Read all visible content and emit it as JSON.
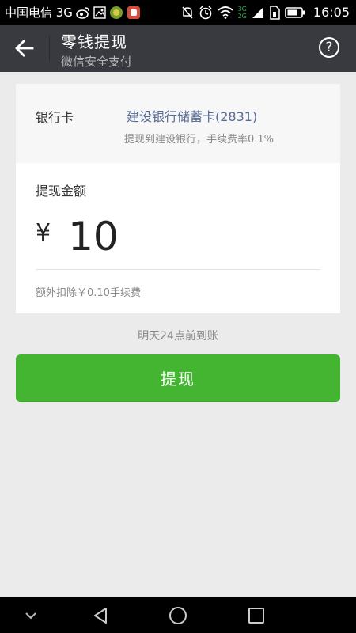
{
  "status_bar": {
    "carrier": "中国电信 3G",
    "network_top": "3G",
    "network_bottom": "2G",
    "time": "16:05"
  },
  "header": {
    "title": "零钱提现",
    "subtitle": "微信安全支付",
    "back_icon": "arrow-left-icon",
    "help_label": "?"
  },
  "bank_card": {
    "label": "银行卡",
    "name": "建设银行储蓄卡(2831)",
    "note": "提现到建设银行，手续费率0.1%"
  },
  "amount": {
    "label": "提现金额",
    "currency_symbol": "¥",
    "value": "10",
    "fee_note": "额外扣除￥0.10手续费"
  },
  "arrival_note": "明天24点前到账",
  "withdraw_button": "提现",
  "colors": {
    "title_bar": "#393a3f",
    "primary_button": "#44b531",
    "link": "#576b95",
    "background": "#ebebeb"
  },
  "nav_icons": [
    "chevron-down-icon",
    "back-triangle-icon",
    "home-circle-icon",
    "recents-square-icon"
  ]
}
